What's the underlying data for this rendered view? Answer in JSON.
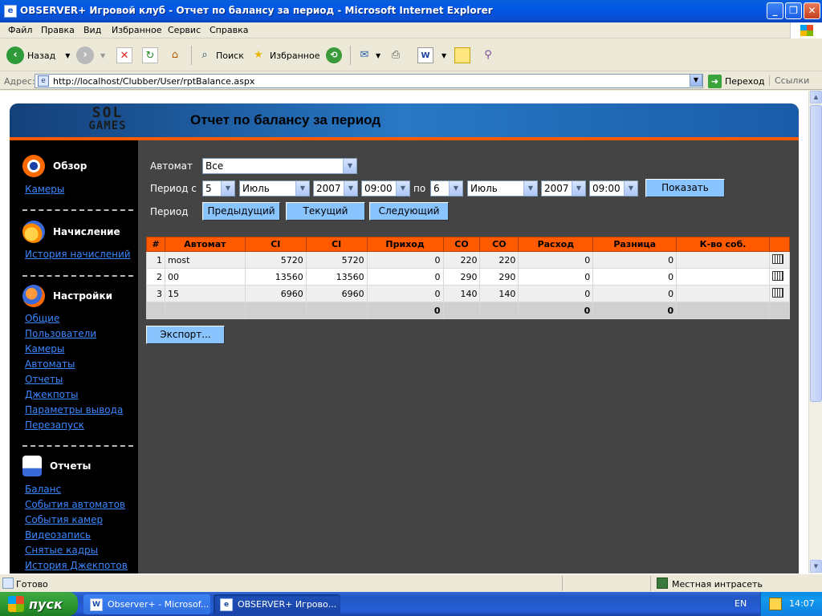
{
  "window": {
    "title": "OBSERVER+ Игровой клуб - Отчет по балансу за период - Microsoft Internet Explorer"
  },
  "menu": [
    "Файл",
    "Правка",
    "Вид",
    "Избранное",
    "Сервис",
    "Справка"
  ],
  "toolbar": {
    "back": "Назад",
    "search": "Поиск",
    "favorites": "Избранное"
  },
  "address": {
    "label": "Адрес:",
    "url": "http://localhost/Clubber/User/rptBalance.aspx",
    "go": "Переход",
    "links": "Ссылки"
  },
  "page": {
    "header": "Отчет по балансу за период",
    "logo": {
      "line1": "SOL",
      "line2": "GAMES"
    }
  },
  "sidebar": {
    "overview": {
      "title": "Обзор",
      "links": [
        "Камеры"
      ]
    },
    "accrual": {
      "title": "Начисление",
      "links": [
        "История начислений"
      ]
    },
    "settings": {
      "title": "Настройки",
      "links": [
        "Общие",
        "Пользователи",
        "Камеры",
        "Автоматы",
        "Отчеты",
        "Джекпоты",
        "Параметры вывода",
        "Перезапуск"
      ]
    },
    "reports": {
      "title": "Отчеты",
      "links": [
        "Баланс",
        "События автоматов",
        "События камер",
        "Видеозапись",
        "Снятые кадры",
        "История Джекпотов"
      ]
    }
  },
  "filters": {
    "machine_label": "Автомат",
    "machine_value": "Все",
    "period_from_label": "Период с",
    "from": {
      "day": "5",
      "month": "Июль",
      "year": "2007",
      "time": "09:00"
    },
    "to_label": "по",
    "to": {
      "day": "6",
      "month": "Июль",
      "year": "2007",
      "time": "09:00"
    },
    "show_button": "Показать",
    "period_label": "Период",
    "prev_button": "Предыдущий",
    "current_button": "Текущий",
    "next_button": "Следующий"
  },
  "table": {
    "headers": [
      "#",
      "Автомат",
      "CI",
      "CI",
      "Приход",
      "CO",
      "CO",
      "Расход",
      "Разница",
      "К-во соб."
    ],
    "rows": [
      {
        "num": "1",
        "machine": "most",
        "ci1": "5720",
        "ci2": "5720",
        "income": "0",
        "co1": "220",
        "co2": "220",
        "expense": "0",
        "diff": "0",
        "count": ""
      },
      {
        "num": "2",
        "machine": "00",
        "ci1": "13560",
        "ci2": "13560",
        "income": "0",
        "co1": "290",
        "co2": "290",
        "expense": "0",
        "diff": "0",
        "count": ""
      },
      {
        "num": "3",
        "machine": "15",
        "ci1": "6960",
        "ci2": "6960",
        "income": "0",
        "co1": "140",
        "co2": "140",
        "expense": "0",
        "diff": "0",
        "count": ""
      }
    ],
    "totals": {
      "income": "0",
      "expense": "0",
      "diff": "0"
    }
  },
  "export_button": "Экспорт...",
  "status": {
    "text": "Готово",
    "zone": "Местная интрасеть"
  },
  "taskbar": {
    "start": "пуск",
    "tasks": [
      "Observer+ - Microsof...",
      "OBSERVER+ Игрово..."
    ],
    "lang": "EN",
    "clock": "14:07"
  },
  "colors": {
    "accent": "#ff5a00",
    "link": "#3a87ff",
    "button": "#8ac4ff",
    "banner": "#2878c4"
  }
}
